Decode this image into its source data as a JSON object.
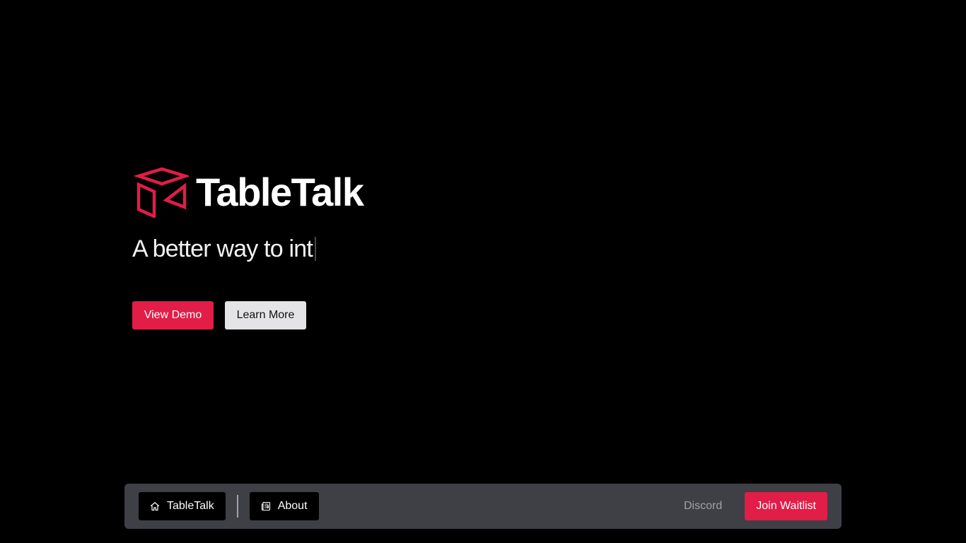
{
  "hero": {
    "brand_name": "TableTalk",
    "tagline": "A better way to int",
    "buttons": {
      "view_demo": "View Demo",
      "learn_more": "Learn More"
    },
    "logo_icon": "box-outline-icon"
  },
  "nav": {
    "home": {
      "label": "TableTalk",
      "icon": "home-icon"
    },
    "about": {
      "label": "About",
      "icon": "newspaper-icon"
    },
    "discord": "Discord",
    "join": "Join Waitlist"
  },
  "colors": {
    "accent": "#e11d48",
    "background": "#000000",
    "nav_bar": "#3f3f46",
    "secondary_button": "#e4e4e7",
    "muted_text": "#a1a1aa"
  }
}
